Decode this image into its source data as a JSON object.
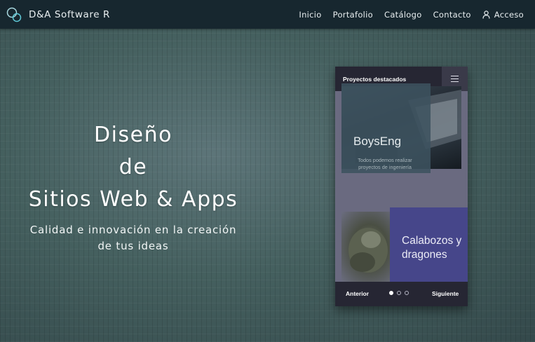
{
  "navbar": {
    "brand": "D&A Software R",
    "links": [
      "Inicio",
      "Portafolio",
      "Catálogo",
      "Contacto"
    ],
    "login": "Acceso",
    "icons": {
      "logo": "circles-logo-icon",
      "login": "user-icon"
    }
  },
  "hero": {
    "title_lines": [
      "Diseño",
      "de",
      "Sitios Web & Apps"
    ],
    "subtitle_lines": [
      "Calidad e innovación en la creación",
      "de tus ideas"
    ]
  },
  "card": {
    "title": "Proyectos destacados",
    "menu_icon": "hamburger-menu-icon",
    "projects": [
      {
        "title": "BoysEng",
        "description_lines": [
          "Todos podemos realizar",
          "proyectos de ingeniería"
        ]
      },
      {
        "title_lines": [
          "Calabozos y",
          "dragones"
        ]
      }
    ],
    "prev_label": "Anterior",
    "next_label": "Siguiente",
    "pagination": {
      "total": 3,
      "active": 1
    }
  },
  "colors": {
    "navbar_bg": "#17272f",
    "card_header_bg": "#262633",
    "accent_blue": "#46468a",
    "text_light": "#ffffff"
  }
}
